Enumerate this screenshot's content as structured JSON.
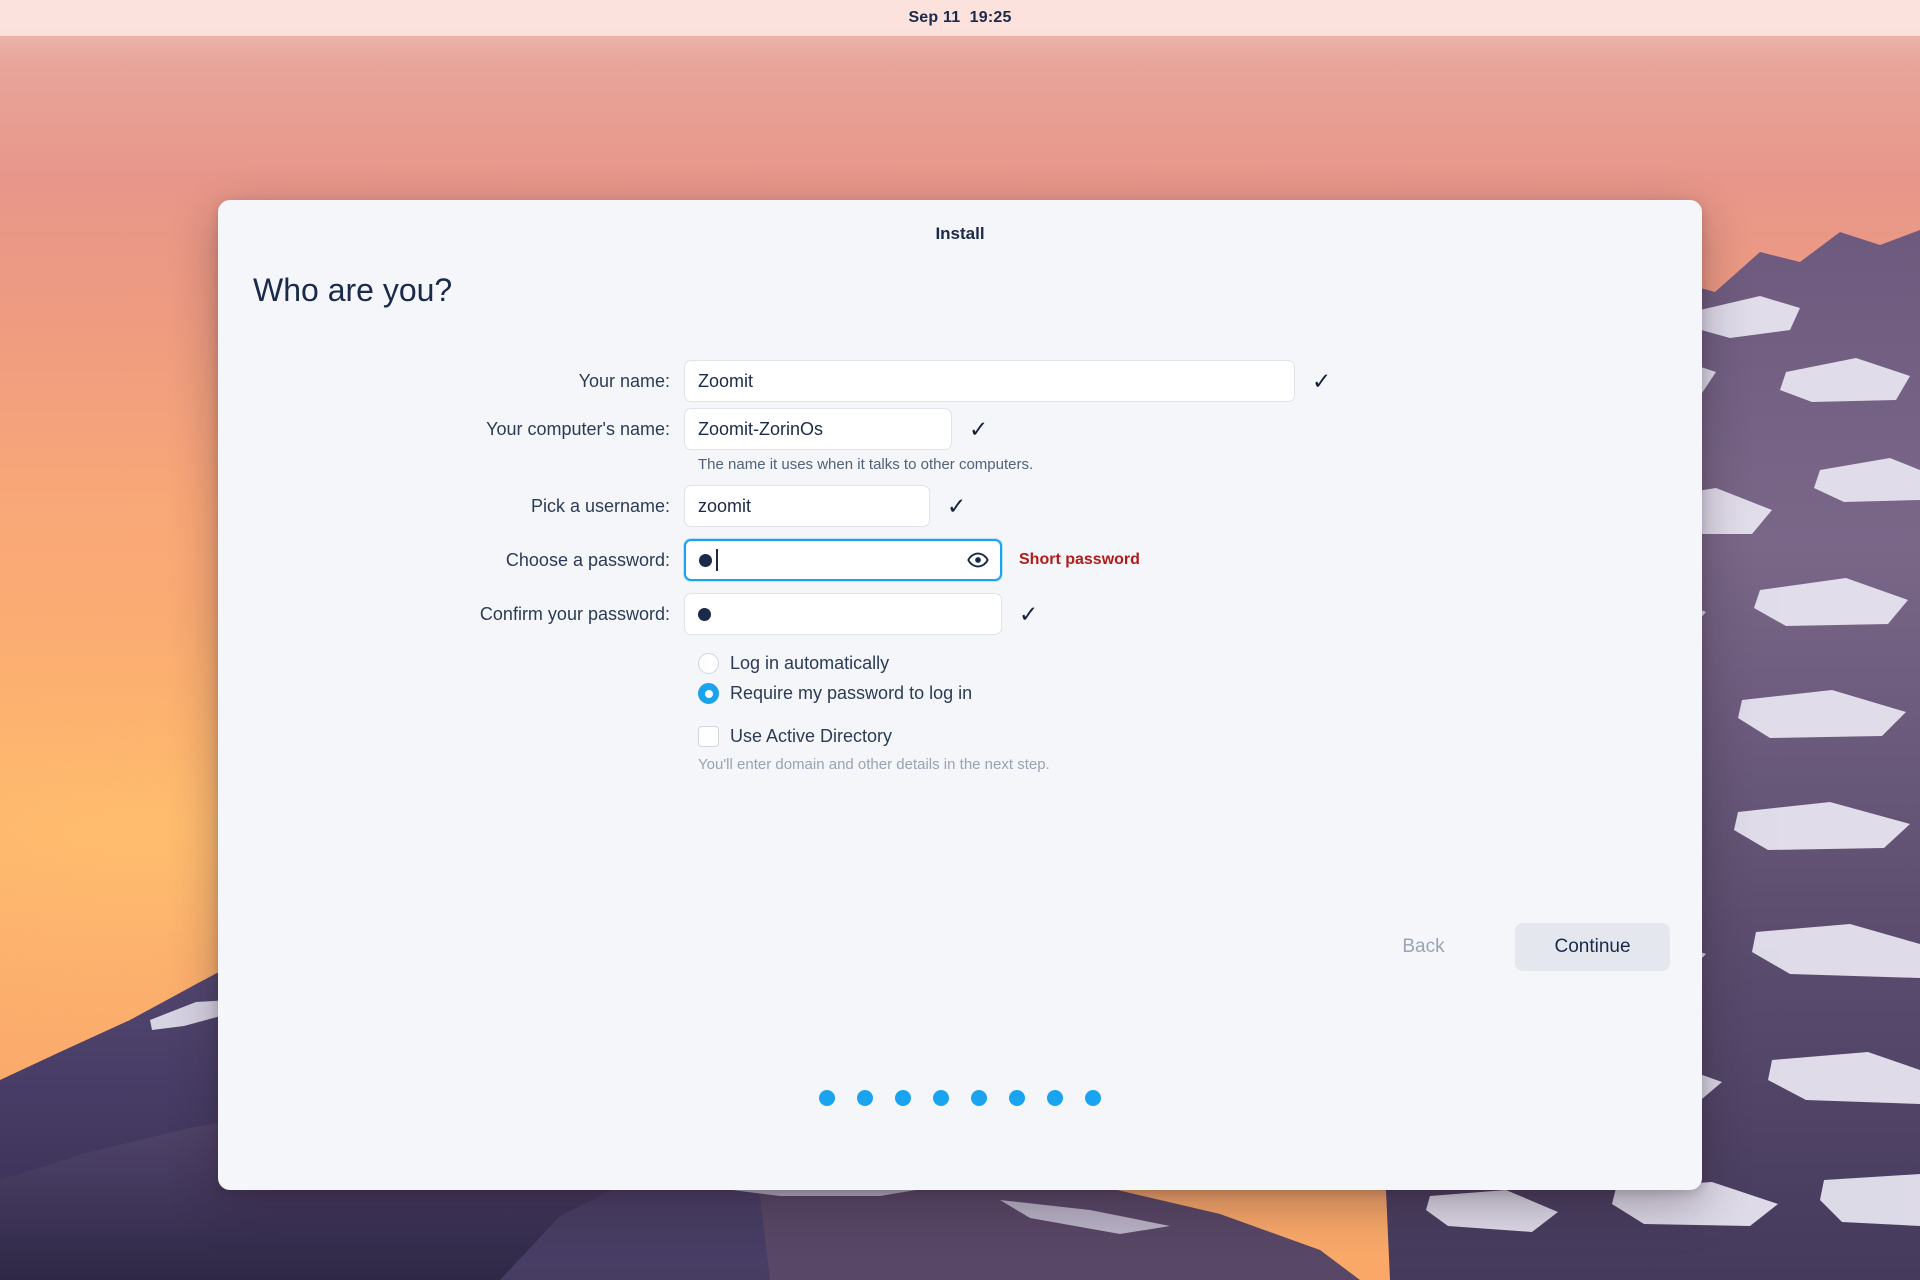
{
  "topbar": {
    "clock": "Sep 11  19:25"
  },
  "dialog": {
    "title": "Install",
    "heading": "Who are you?",
    "fields": [
      {
        "label": "Your name:",
        "value": "Zoomit",
        "status_icon": "check-icon",
        "status": "✓"
      },
      {
        "label": "Your computer's name:",
        "value": "Zoomit-ZorinOs",
        "status_icon": "check-icon",
        "status": "✓",
        "hint": "The name it uses when it talks to other computers."
      },
      {
        "label": "Pick a username:",
        "value": "zoomit",
        "status_icon": "check-icon",
        "status": "✓"
      },
      {
        "label": "Choose a password:",
        "value": "•",
        "status_icon": "eye-icon",
        "warning": "Short password",
        "focused": true
      },
      {
        "label": "Confirm your password:",
        "value": "•",
        "status_icon": "check-icon",
        "status": "✓"
      }
    ],
    "login_options": [
      {
        "label": "Log in automatically",
        "selected": false
      },
      {
        "label": "Require my password to log in",
        "selected": true
      }
    ],
    "active_directory": {
      "label": "Use Active Directory",
      "checked": false,
      "hint": "You'll enter domain and other details in the next step."
    },
    "buttons": {
      "back": "Back",
      "continue": "Continue"
    },
    "progress_dots": {
      "count": 8,
      "color": "#1aa3ef"
    }
  },
  "colors": {
    "accent": "#1aa3ef",
    "warning": "#b41a1a",
    "dialog_bg": "#f4f6f9",
    "text": "#1b2a4a",
    "topbar_bg": "#fce5df"
  }
}
